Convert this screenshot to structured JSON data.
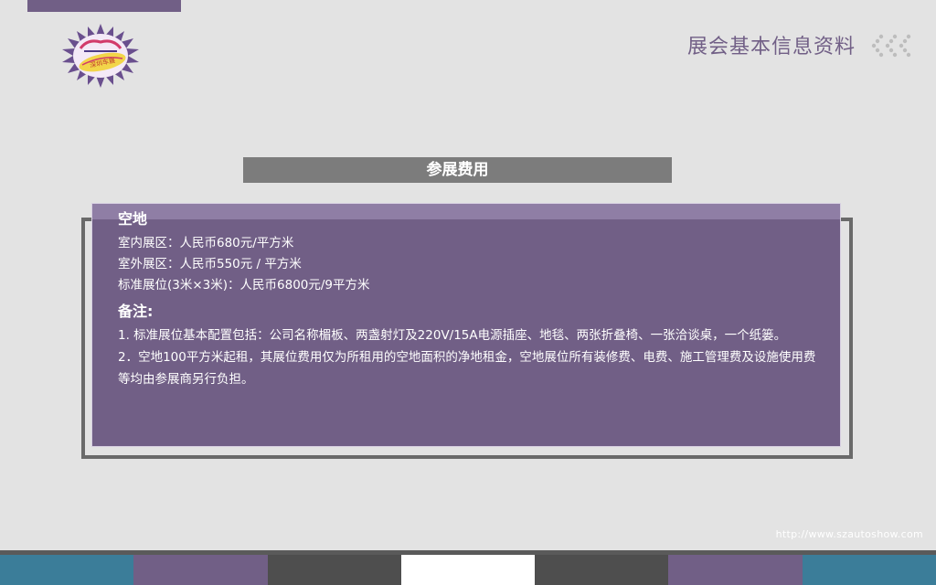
{
  "header": {
    "title": "展会基本信息资料"
  },
  "logo": {
    "text": "深圳车展"
  },
  "section": {
    "title": "参展费用"
  },
  "panel": {
    "heading": "空地",
    "prices": [
      "室内展区：人民币680元/平方米",
      "室外展区：人民币550元 / 平方米",
      "标准展位(3米×3米)：人民币6800元/9平方米"
    ],
    "remark_heading": "备注:",
    "notes": [
      "1. 标准展位基本配置包括：公司名称楣板、两盏射灯及220V/15A电源插座、地毯、两张折叠椅、一张洽谈桌，一个纸篓。",
      "2．空地100平方米起租，其展位费用仅为所租用的空地面积的净地租金，空地展位所有装修费、电费、施工管理费及设施使用费等均由参展商另行负担。"
    ]
  },
  "footer": {
    "url": "http://www.szautoshow.com"
  },
  "colors": {
    "accent_purple": "#715f86",
    "teal": "#3b7d99",
    "dark_gray": "#4e4e4e",
    "white": "#ffffff",
    "background": "#e3e3e3"
  },
  "bottom_bar": [
    "#3b7d99",
    "#715f86",
    "#4e4e4e",
    "#ffffff",
    "#4e4e4e",
    "#715f86",
    "#3b7d99"
  ]
}
